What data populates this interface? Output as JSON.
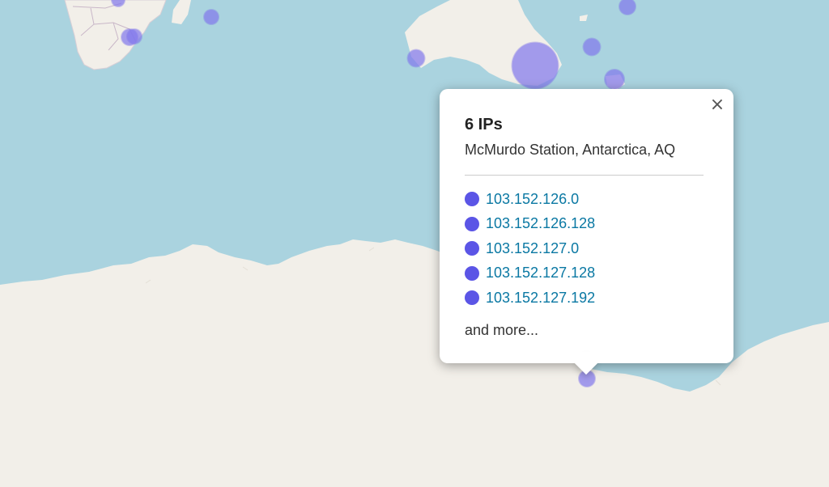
{
  "map": {
    "background_color": "#aad3df",
    "land_color": "#f2efe9",
    "marker_color": "#8278eb"
  },
  "popup": {
    "close_icon": "×",
    "title": "6 IPs",
    "location": "McMurdo Station, Antarctica, AQ",
    "ips": [
      "103.152.126.0",
      "103.152.126.128",
      "103.152.127.0",
      "103.152.127.128",
      "103.152.127.192"
    ],
    "more_label": "and more...",
    "ip_dot_color": "#5b55e6",
    "link_color": "#0a78a3"
  }
}
